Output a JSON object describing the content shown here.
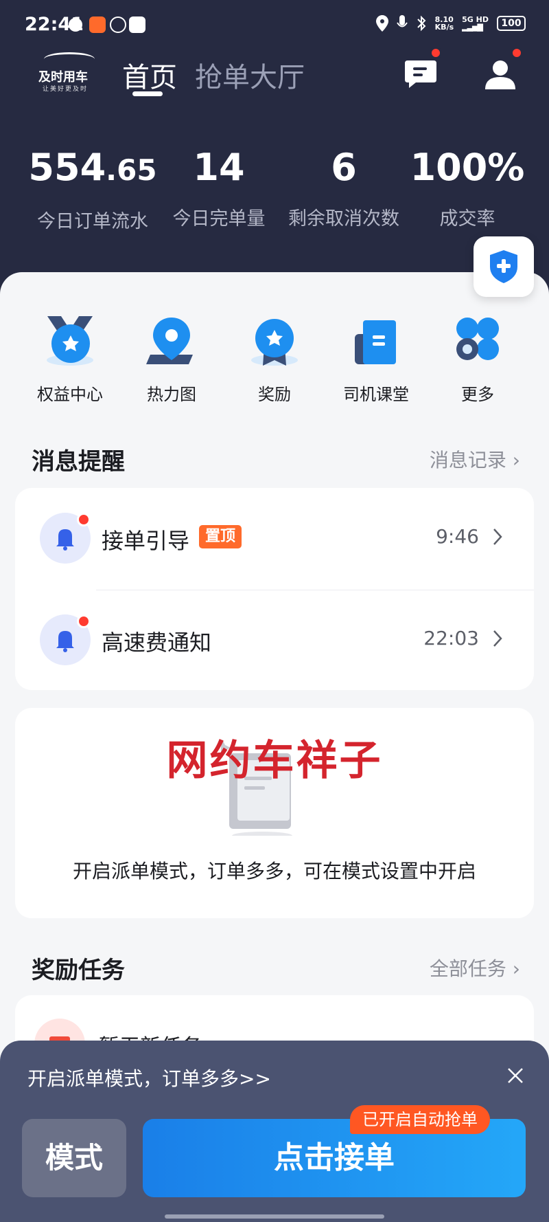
{
  "status_bar": {
    "time": "22:41",
    "net_speed": "8.10",
    "net_speed_unit": "KB/s",
    "network": "5G HD",
    "battery": "100"
  },
  "header": {
    "logo_name": "及时用车",
    "logo_slogan": "让美好更及时",
    "tabs": [
      {
        "label": "首页",
        "active": true
      },
      {
        "label": "抢单大厅",
        "active": false
      }
    ],
    "message_icon": "chat-icon",
    "profile_icon": "user-icon"
  },
  "stats": [
    {
      "value_int": "554",
      "value_dec": ".65",
      "label": "今日订单流水"
    },
    {
      "value_int": "14",
      "value_dec": "",
      "label": "今日完单量"
    },
    {
      "value_int": "6",
      "value_dec": "",
      "label": "剩余取消次数"
    },
    {
      "value_int": "100%",
      "value_dec": "",
      "label": "成交率"
    }
  ],
  "quick_actions": [
    {
      "label": "权益中心",
      "icon": "medal-icon"
    },
    {
      "label": "热力图",
      "icon": "map-pin-icon"
    },
    {
      "label": "奖励",
      "icon": "reward-icon"
    },
    {
      "label": "司机课堂",
      "icon": "book-icon"
    },
    {
      "label": "更多",
      "icon": "grid-icon"
    }
  ],
  "messages": {
    "title": "消息提醒",
    "link": "消息记录",
    "items": [
      {
        "title": "接单引导",
        "badge": "置顶",
        "time": "9:46"
      },
      {
        "title": "高速费通知",
        "badge": "",
        "time": "22:03"
      }
    ]
  },
  "watermark": "网约车祥子",
  "empty_notice": "开启派单模式，订单多多，可在模式设置中开启",
  "tasks": {
    "title": "奖励任务",
    "link": "全部任务",
    "first_item": "暂无新任务"
  },
  "bottom": {
    "banner": "开启派单模式，订单多多>>",
    "mode_label": "模式",
    "grab_label": "点击接单",
    "auto_tag": "已开启自动抢单"
  },
  "colors": {
    "header_bg": "#262a41",
    "accent_blue": "#1a8df0",
    "alert_red": "#ff3b30",
    "tag_orange": "#ff5722"
  }
}
